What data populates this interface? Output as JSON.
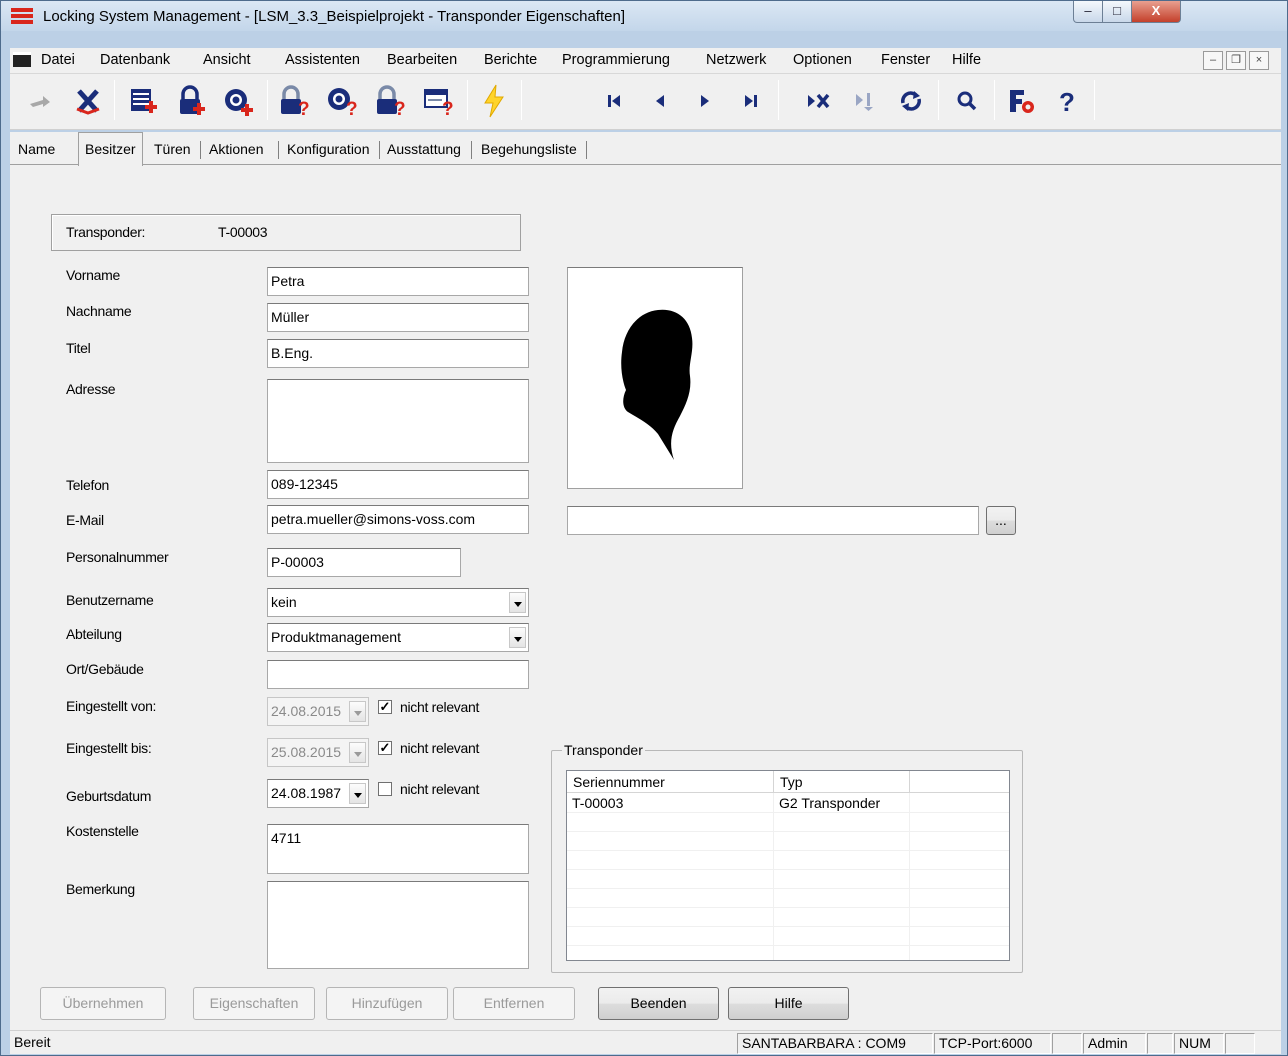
{
  "window": {
    "title": "Locking System Management - [LSM_3.3_Beispielprojekt - Transponder Eigenschaften]",
    "controls": {
      "minimize": "–",
      "maximize": "□",
      "close": "X"
    }
  },
  "menu": {
    "items": [
      "Datei",
      "Datenbank",
      "Ansicht",
      "Assistenten",
      "Bearbeiten",
      "Berichte",
      "Programmierung",
      "Netzwerk",
      "Optionen",
      "Fenster",
      "Hilfe"
    ],
    "mdi_buttons": [
      "–",
      "❐",
      "×"
    ]
  },
  "toolbar": {
    "icons": [
      "transfer-icon",
      "cancel-icon",
      "new-person-icon",
      "new-lock-icon",
      "new-transponder-icon",
      "lock-query-icon",
      "transponder-query-icon",
      "lock-identify-icon",
      "programming-query-icon",
      "program-icon",
      "first-record-icon",
      "previous-record-icon",
      "next-record-icon",
      "last-record-icon",
      "delete-record-icon",
      "insert-record-icon",
      "refresh-icon",
      "search-icon",
      "filter-settings-icon",
      "help-icon"
    ]
  },
  "tabs": [
    "Name",
    "Besitzer",
    "Türen",
    "Aktionen",
    "Konfiguration",
    "Ausstattung",
    "Begehungsliste"
  ],
  "transponder": {
    "label": "Transponder:",
    "value": "T-00003"
  },
  "form": {
    "vorname": {
      "label": "Vorname",
      "value": "Petra"
    },
    "nachname": {
      "label": "Nachname",
      "value": "Müller"
    },
    "titel": {
      "label": "Titel",
      "value": "B.Eng."
    },
    "adresse": {
      "label": "Adresse",
      "value": ""
    },
    "telefon": {
      "label": "Telefon",
      "value": "089-12345"
    },
    "email": {
      "label": "E-Mail",
      "value": "petra.mueller@simons-voss.com"
    },
    "personalnummer": {
      "label": "Personalnummer",
      "value": "P-00003"
    },
    "benutzername": {
      "label": "Benutzername",
      "value": "kein"
    },
    "abteilung": {
      "label": "Abteilung",
      "value": "Produktmanagement"
    },
    "ort": {
      "label": "Ort/Gebäude",
      "value": ""
    },
    "eingestellt_von": {
      "label": "Eingestellt von:",
      "value": "24.08.2015",
      "checkbox_label": "nicht relevant",
      "checked": true
    },
    "eingestellt_bis": {
      "label": "Eingestellt bis:",
      "value": "25.08.2015",
      "checkbox_label": "nicht relevant",
      "checked": true
    },
    "geburtsdatum": {
      "label": "Geburtsdatum",
      "value": "24.08.1987",
      "checkbox_label": "nicht relevant",
      "checked": false
    },
    "kostenstelle": {
      "label": "Kostenstelle",
      "value": "4711"
    },
    "bemerkung": {
      "label": "Bemerkung",
      "value": ""
    }
  },
  "photo": {
    "path_value": "",
    "browse_label": "..."
  },
  "transponder_group": {
    "title": "Transponder",
    "columns": [
      "Seriennummer",
      "Typ",
      ""
    ],
    "rows": [
      [
        "T-00003",
        "G2 Transponder",
        ""
      ]
    ]
  },
  "buttons": {
    "uebernehmen": "Übernehmen",
    "eigenschaften": "Eigenschaften",
    "hinzufuegen": "Hinzufügen",
    "entfernen": "Entfernen",
    "beenden": "Beenden",
    "hilfe": "Hilfe"
  },
  "statusbar": {
    "status": "Bereit",
    "connection": "SANTABARBARA : COM9",
    "port": "TCP-Port:6000",
    "user": "Admin",
    "num": "NUM"
  },
  "colors": {
    "accent_red": "#d9261c",
    "title_bar": "#c3d6ea",
    "face": "#f0f0f0"
  }
}
